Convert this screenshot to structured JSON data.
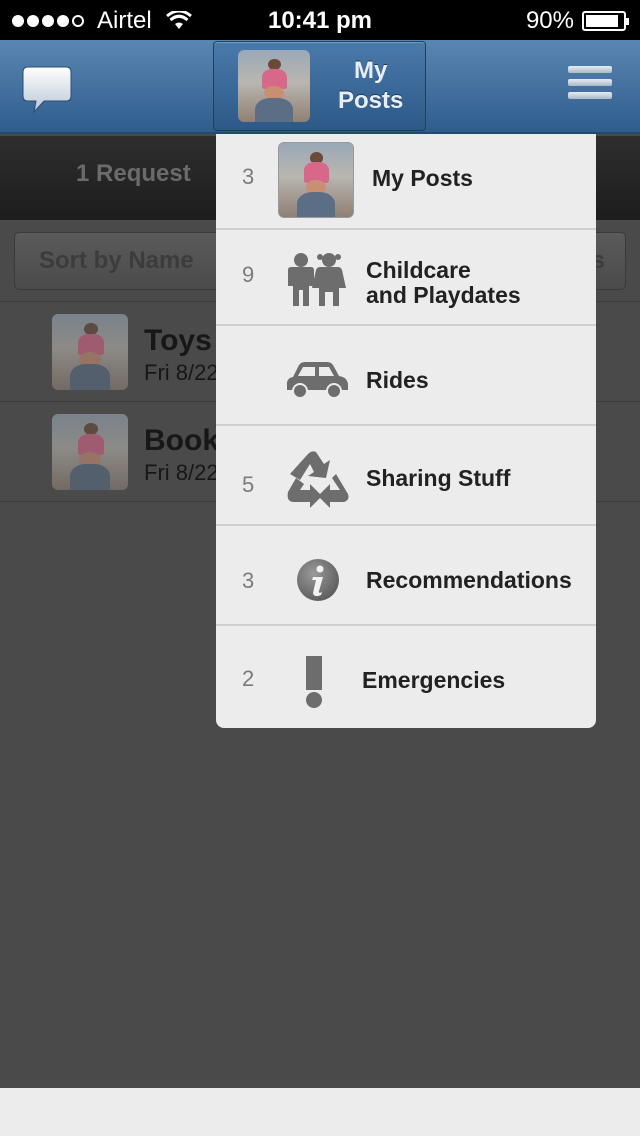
{
  "status_bar": {
    "carrier": "Airtel",
    "time": "10:41 pm",
    "battery": "90%",
    "battery_level": 0.9,
    "signal_bars": 4
  },
  "nav": {
    "title_line1": "My",
    "title_line2": "Posts",
    "chat_icon": "chat-bubble-icon",
    "menu_icon": "hamburger-menu-icon"
  },
  "background": {
    "request_text": "1  Request",
    "sort_label": "Sort by Name",
    "sort_right": "s",
    "rows": [
      {
        "title": "Toys",
        "date": "Fri 8/22"
      },
      {
        "title": "Book",
        "date": "Fri 8/22"
      }
    ]
  },
  "menu": {
    "items": [
      {
        "count": "3",
        "line1": "My Posts",
        "line2": "",
        "icon": "avatar-photo"
      },
      {
        "count": "9",
        "line1": "Childcare",
        "line2": "and Playdates",
        "icon": "children-icon"
      },
      {
        "count": "",
        "line1": "Rides",
        "line2": "",
        "icon": "car-icon"
      },
      {
        "count": "5",
        "line1": "Sharing Stuff",
        "line2": "",
        "icon": "recycle-icon"
      },
      {
        "count": "3",
        "line1": "Recommendations",
        "line2": "",
        "icon": "info-icon"
      },
      {
        "count": "2",
        "line1": "Emergencies",
        "line2": "",
        "icon": "exclamation-icon"
      }
    ]
  },
  "colors": {
    "nav_blue": "#3c6b9c",
    "menu_bg": "#ececec",
    "overlay_gray": "#4a4a4a"
  }
}
